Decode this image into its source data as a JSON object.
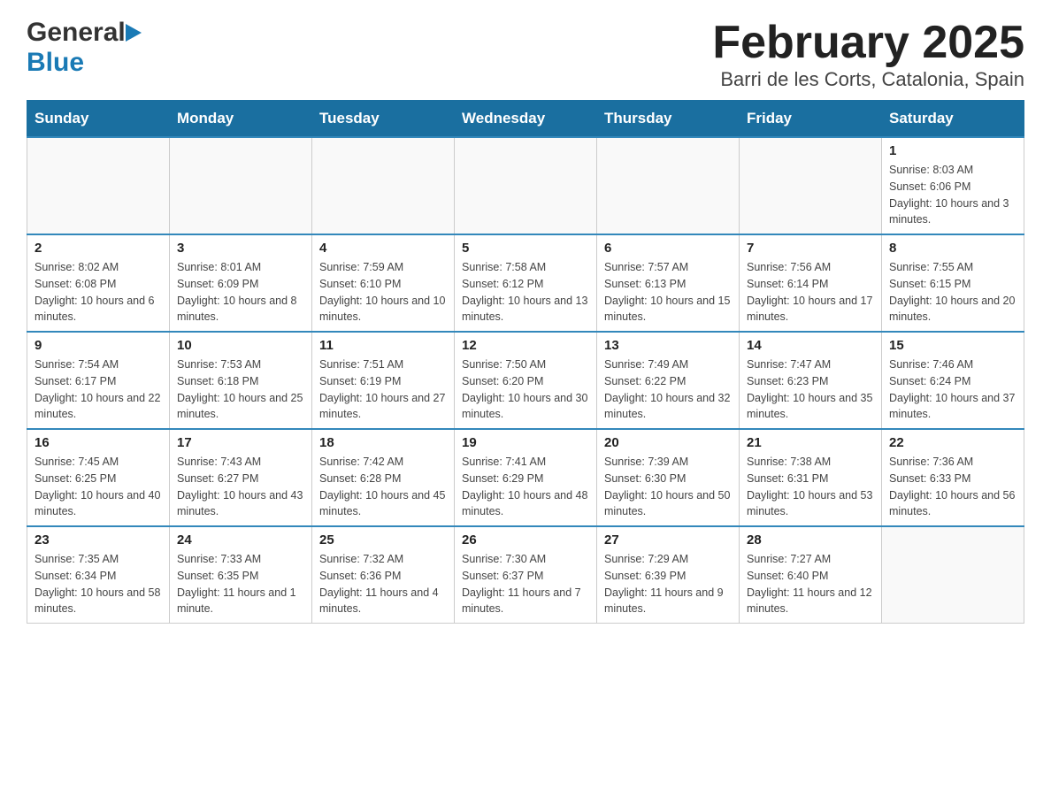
{
  "header": {
    "logo_general": "General",
    "logo_blue": "Blue",
    "title": "February 2025",
    "subtitle": "Barri de les Corts, Catalonia, Spain"
  },
  "weekdays": [
    "Sunday",
    "Monday",
    "Tuesday",
    "Wednesday",
    "Thursday",
    "Friday",
    "Saturday"
  ],
  "weeks": [
    [
      {
        "day": "",
        "info": ""
      },
      {
        "day": "",
        "info": ""
      },
      {
        "day": "",
        "info": ""
      },
      {
        "day": "",
        "info": ""
      },
      {
        "day": "",
        "info": ""
      },
      {
        "day": "",
        "info": ""
      },
      {
        "day": "1",
        "info": "Sunrise: 8:03 AM\nSunset: 6:06 PM\nDaylight: 10 hours and 3 minutes."
      }
    ],
    [
      {
        "day": "2",
        "info": "Sunrise: 8:02 AM\nSunset: 6:08 PM\nDaylight: 10 hours and 6 minutes."
      },
      {
        "day": "3",
        "info": "Sunrise: 8:01 AM\nSunset: 6:09 PM\nDaylight: 10 hours and 8 minutes."
      },
      {
        "day": "4",
        "info": "Sunrise: 7:59 AM\nSunset: 6:10 PM\nDaylight: 10 hours and 10 minutes."
      },
      {
        "day": "5",
        "info": "Sunrise: 7:58 AM\nSunset: 6:12 PM\nDaylight: 10 hours and 13 minutes."
      },
      {
        "day": "6",
        "info": "Sunrise: 7:57 AM\nSunset: 6:13 PM\nDaylight: 10 hours and 15 minutes."
      },
      {
        "day": "7",
        "info": "Sunrise: 7:56 AM\nSunset: 6:14 PM\nDaylight: 10 hours and 17 minutes."
      },
      {
        "day": "8",
        "info": "Sunrise: 7:55 AM\nSunset: 6:15 PM\nDaylight: 10 hours and 20 minutes."
      }
    ],
    [
      {
        "day": "9",
        "info": "Sunrise: 7:54 AM\nSunset: 6:17 PM\nDaylight: 10 hours and 22 minutes."
      },
      {
        "day": "10",
        "info": "Sunrise: 7:53 AM\nSunset: 6:18 PM\nDaylight: 10 hours and 25 minutes."
      },
      {
        "day": "11",
        "info": "Sunrise: 7:51 AM\nSunset: 6:19 PM\nDaylight: 10 hours and 27 minutes."
      },
      {
        "day": "12",
        "info": "Sunrise: 7:50 AM\nSunset: 6:20 PM\nDaylight: 10 hours and 30 minutes."
      },
      {
        "day": "13",
        "info": "Sunrise: 7:49 AM\nSunset: 6:22 PM\nDaylight: 10 hours and 32 minutes."
      },
      {
        "day": "14",
        "info": "Sunrise: 7:47 AM\nSunset: 6:23 PM\nDaylight: 10 hours and 35 minutes."
      },
      {
        "day": "15",
        "info": "Sunrise: 7:46 AM\nSunset: 6:24 PM\nDaylight: 10 hours and 37 minutes."
      }
    ],
    [
      {
        "day": "16",
        "info": "Sunrise: 7:45 AM\nSunset: 6:25 PM\nDaylight: 10 hours and 40 minutes."
      },
      {
        "day": "17",
        "info": "Sunrise: 7:43 AM\nSunset: 6:27 PM\nDaylight: 10 hours and 43 minutes."
      },
      {
        "day": "18",
        "info": "Sunrise: 7:42 AM\nSunset: 6:28 PM\nDaylight: 10 hours and 45 minutes."
      },
      {
        "day": "19",
        "info": "Sunrise: 7:41 AM\nSunset: 6:29 PM\nDaylight: 10 hours and 48 minutes."
      },
      {
        "day": "20",
        "info": "Sunrise: 7:39 AM\nSunset: 6:30 PM\nDaylight: 10 hours and 50 minutes."
      },
      {
        "day": "21",
        "info": "Sunrise: 7:38 AM\nSunset: 6:31 PM\nDaylight: 10 hours and 53 minutes."
      },
      {
        "day": "22",
        "info": "Sunrise: 7:36 AM\nSunset: 6:33 PM\nDaylight: 10 hours and 56 minutes."
      }
    ],
    [
      {
        "day": "23",
        "info": "Sunrise: 7:35 AM\nSunset: 6:34 PM\nDaylight: 10 hours and 58 minutes."
      },
      {
        "day": "24",
        "info": "Sunrise: 7:33 AM\nSunset: 6:35 PM\nDaylight: 11 hours and 1 minute."
      },
      {
        "day": "25",
        "info": "Sunrise: 7:32 AM\nSunset: 6:36 PM\nDaylight: 11 hours and 4 minutes."
      },
      {
        "day": "26",
        "info": "Sunrise: 7:30 AM\nSunset: 6:37 PM\nDaylight: 11 hours and 7 minutes."
      },
      {
        "day": "27",
        "info": "Sunrise: 7:29 AM\nSunset: 6:39 PM\nDaylight: 11 hours and 9 minutes."
      },
      {
        "day": "28",
        "info": "Sunrise: 7:27 AM\nSunset: 6:40 PM\nDaylight: 11 hours and 12 minutes."
      },
      {
        "day": "",
        "info": ""
      }
    ]
  ]
}
